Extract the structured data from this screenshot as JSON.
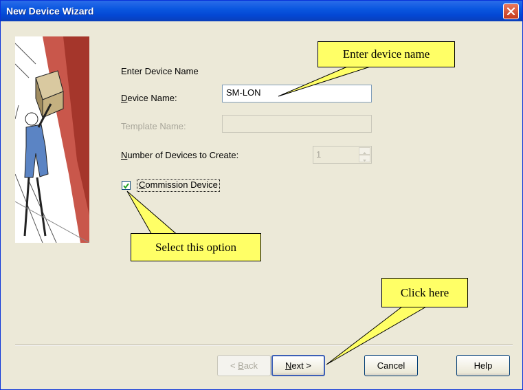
{
  "window": {
    "title": "New Device Wizard"
  },
  "form": {
    "heading": "Enter Device Name",
    "device_name_label_mnemonic": "D",
    "device_name_label_rest": "evice Name:",
    "device_name_value": "SM-LON",
    "template_name_label": "Template Name:",
    "template_name_value": "",
    "num_devices_label_mnemonic": "N",
    "num_devices_label_rest": "umber of Devices to Create:",
    "num_devices_value": "1",
    "commission_label_mnemonic": "C",
    "commission_label_rest": "ommission Device",
    "commission_checked": true
  },
  "buttons": {
    "back_prefix": "< ",
    "back_mnemonic": "B",
    "back_rest": "ack",
    "next_mnemonic": "N",
    "next_rest": "ext >",
    "cancel": "Cancel",
    "help": "Help"
  },
  "callouts": {
    "enter_name": "Enter device name",
    "select_option": "Select this option",
    "click_here": "Click here"
  },
  "colors": {
    "titlebar": "#0a57e0",
    "dialog_bg": "#ece9d8",
    "callout_fill": "#ffff66",
    "artwork_accent": "#c0392b"
  },
  "icons": {
    "close": "close-icon",
    "checkmark": "checkmark-icon",
    "spin_up": "spin-up-icon",
    "spin_down": "spin-down-icon",
    "wizard_art": "wizard-illustration"
  }
}
